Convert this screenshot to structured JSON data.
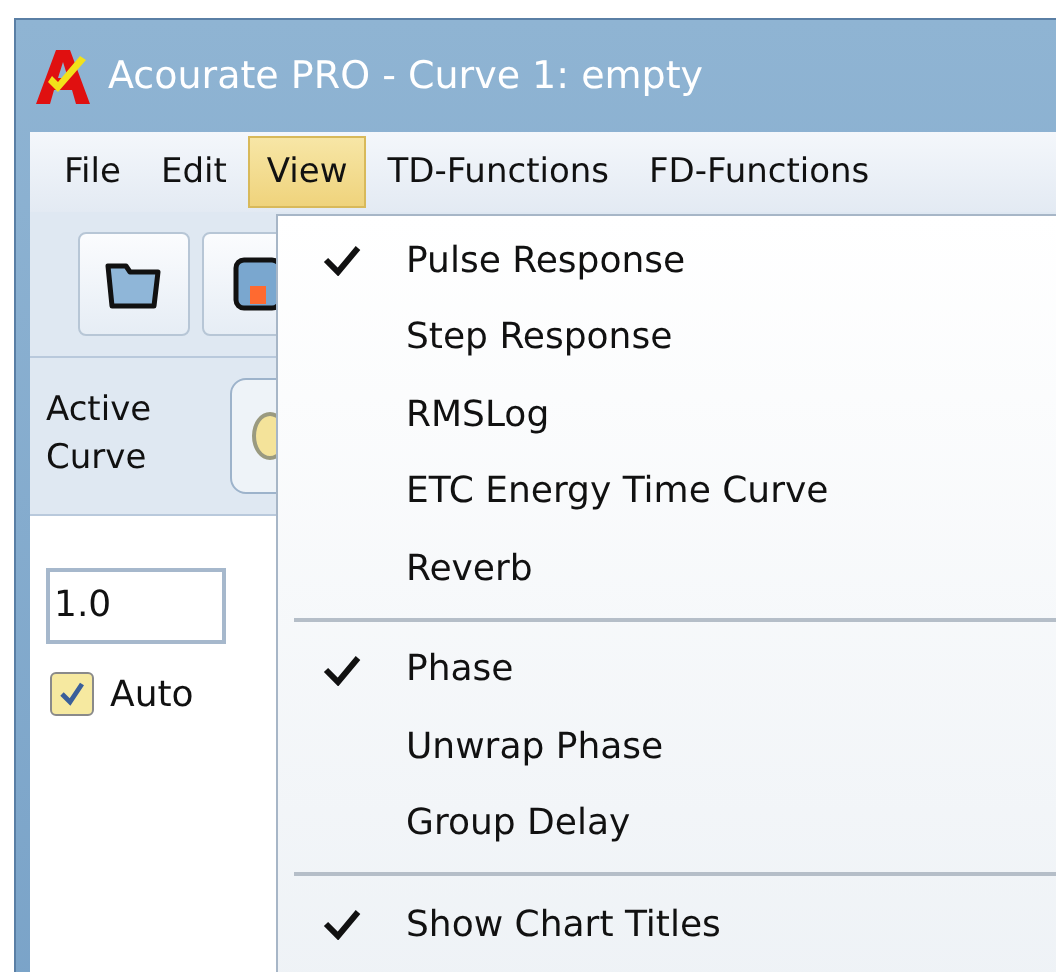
{
  "window": {
    "title": "Acourate PRO - Curve 1: empty"
  },
  "menu_bar": [
    {
      "label": "File",
      "selected": false
    },
    {
      "label": "Edit",
      "selected": false
    },
    {
      "label": "View",
      "selected": true
    },
    {
      "label": "TD-Functions",
      "selected": false
    },
    {
      "label": "FD-Functions",
      "selected": false
    }
  ],
  "active_curve": {
    "label": "Active Curve"
  },
  "scale_field": {
    "value": "1.0"
  },
  "auto_checkbox": {
    "label": "Auto",
    "checked": true
  },
  "view_menu": {
    "groups": [
      [
        {
          "label": "Pulse Response",
          "checked": true
        },
        {
          "label": "Step Response",
          "checked": false
        },
        {
          "label": "RMSLog",
          "checked": false
        },
        {
          "label": "ETC Energy Time Curve",
          "checked": false
        },
        {
          "label": "Reverb",
          "checked": false
        }
      ],
      [
        {
          "label": "Phase",
          "checked": true
        },
        {
          "label": "Unwrap Phase",
          "checked": false
        },
        {
          "label": "Group Delay",
          "checked": false
        }
      ],
      [
        {
          "label": "Show Chart Titles",
          "checked": true
        }
      ]
    ]
  }
}
